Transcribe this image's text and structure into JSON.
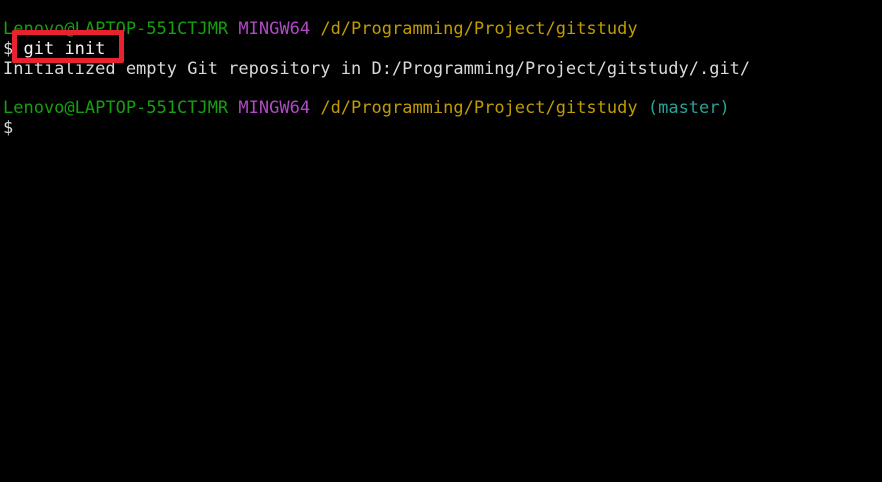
{
  "terminal": {
    "lines": [
      {
        "kind": "prompt",
        "user_host": "Lenovo@LAPTOP-551CTJMR",
        "system": "MINGW64",
        "path": "/d/Programming/Project/gitstudy",
        "branch": ""
      },
      {
        "kind": "command",
        "prompt_symbol": "$",
        "command": "git init"
      },
      {
        "kind": "output",
        "text": "Initialized empty Git repository in D:/Programming/Project/gitstudy/.git/"
      },
      {
        "kind": "prompt",
        "user_host": "Lenovo@LAPTOP-551CTJMR",
        "system": "MINGW64",
        "path": "/d/Programming/Project/gitstudy",
        "branch": "(master)"
      },
      {
        "kind": "command",
        "prompt_symbol": "$",
        "command": ""
      }
    ]
  },
  "colors": {
    "background": "#000000",
    "user_host": "#13a10e",
    "system": "#b148c6",
    "path": "#c19c00",
    "branch": "#2aa198",
    "text": "#d9d9d9",
    "highlight": "#e8232f"
  }
}
